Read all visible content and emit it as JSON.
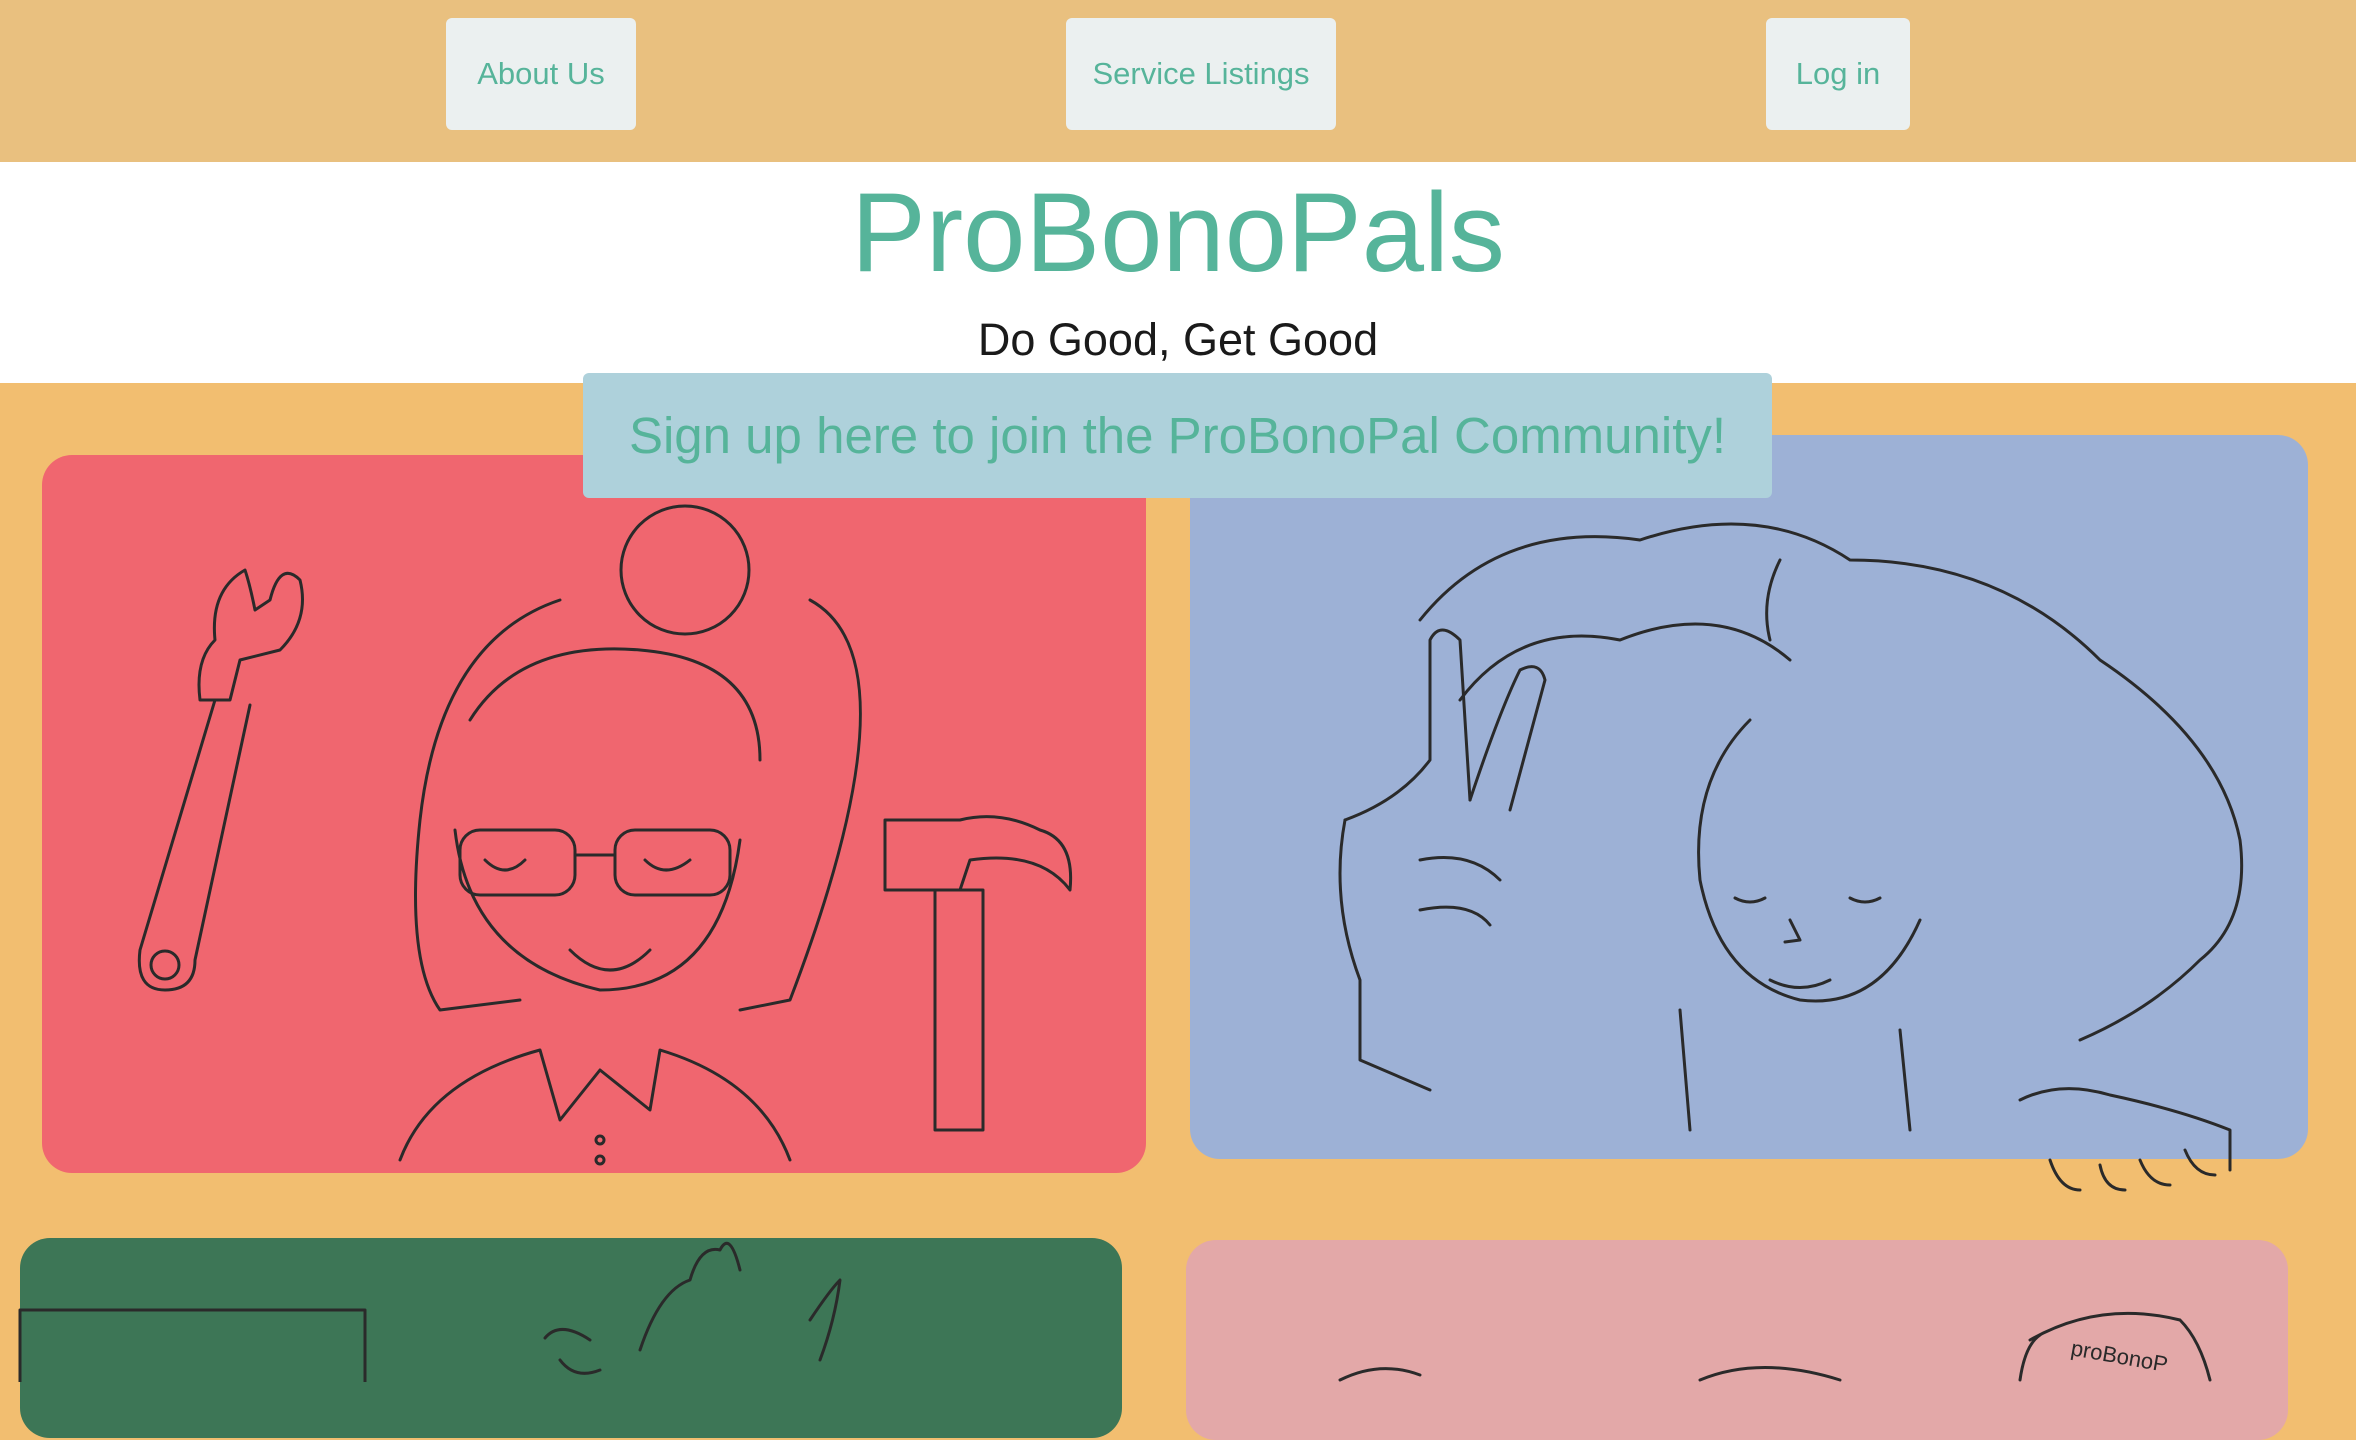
{
  "nav": {
    "about_label": "About Us",
    "services_label": "Service Listings",
    "login_label": "Log in"
  },
  "hero": {
    "title": "ProBonoPals",
    "tagline": "Do Good, Get Good"
  },
  "signup": {
    "label": "Sign up here to join the ProBonoPal Community!"
  },
  "colors": {
    "accent": "#56b49a",
    "topbar": "#e9c07f",
    "background": "#f2be70",
    "panel_red": "#f0666f",
    "panel_blue": "#9db1d6",
    "panel_green": "#3d7656",
    "panel_pink": "#e3a8a8",
    "signup_bg": "#aed1db"
  },
  "illustrations": {
    "panel_1": "woman-with-glasses-wrench-hammer-illustration",
    "panel_2": "woman-peace-sign-illustration",
    "panel_3": "cat-illustration",
    "panel_4": "probonopals-mug-illustration",
    "mug_text": "proBonoP"
  }
}
